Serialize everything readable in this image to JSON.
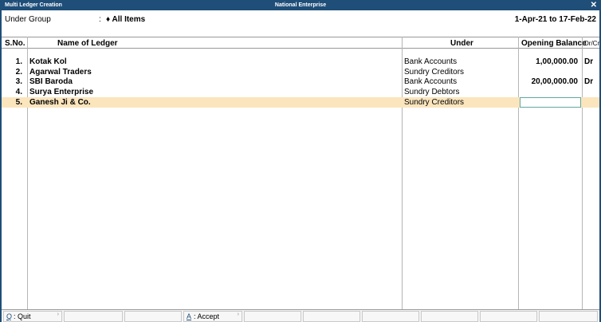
{
  "window": {
    "title": "Multi Ledger Creation",
    "company": "National Enterprise",
    "close_glyph": "✕"
  },
  "header": {
    "under_group_label": "Under Group",
    "colon": ":",
    "under_group_value": "♦ All Items",
    "period": "1-Apr-21 to 17-Feb-22"
  },
  "columns": {
    "sno": "S.No.",
    "name": "Name of Ledger",
    "under": "Under",
    "opening_balance": "Opening Balance",
    "drcr": "Dr/Cr"
  },
  "rows": [
    {
      "sno": "1.",
      "name": "Kotak Kol",
      "under": "Bank Accounts",
      "balance": "1,00,000.00",
      "drcr": "Dr"
    },
    {
      "sno": "2.",
      "name": "Agarwal Traders",
      "under": "Sundry Creditors",
      "balance": "",
      "drcr": ""
    },
    {
      "sno": "3.",
      "name": "SBI Baroda",
      "under": "Bank Accounts",
      "balance": "20,00,000.00",
      "drcr": "Dr"
    },
    {
      "sno": "4.",
      "name": "Surya Enterprise",
      "under": "Sundry Debtors",
      "balance": "",
      "drcr": ""
    },
    {
      "sno": "5.",
      "name": "Ganesh Ji & Co.",
      "under": "Sundry Creditors",
      "balance": "",
      "drcr": ""
    }
  ],
  "footer": {
    "quit_key": "Q",
    "quit_label": ": Quit",
    "accept_key": "A",
    "accept_label": ": Accept"
  },
  "colors": {
    "title_bar": "#1f4e79",
    "selected_row": "#fbe5bd",
    "active_field_border": "#5fa8a0"
  }
}
